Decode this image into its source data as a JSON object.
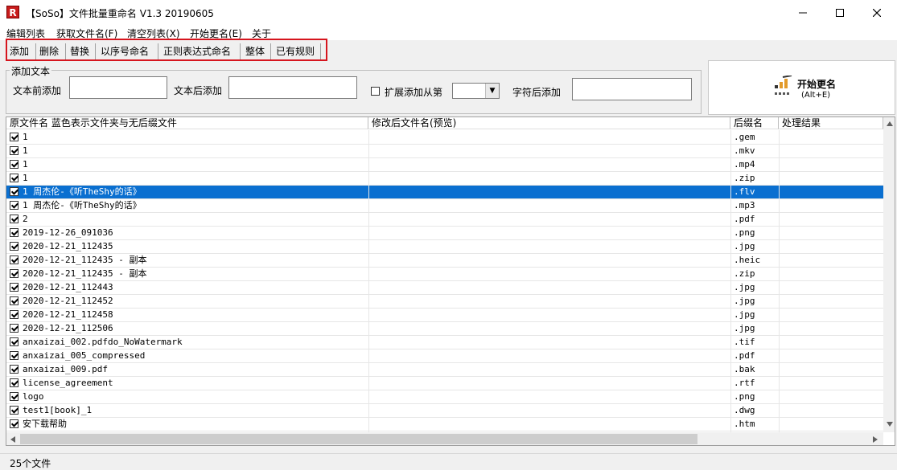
{
  "window": {
    "title": "【SoSo】文件批量重命名   V1.3 20190605",
    "icon_letter": "R"
  },
  "menu": [
    {
      "label": "编辑列表"
    },
    {
      "label": "获取文件名(F)"
    },
    {
      "label": "清空列表(X)"
    },
    {
      "label": "开始更名(E)"
    },
    {
      "label": "关于"
    }
  ],
  "tabs": [
    {
      "label": "添加"
    },
    {
      "label": "删除"
    },
    {
      "label": "替换"
    },
    {
      "label": "以序号命名"
    },
    {
      "label": "正则表达式命名"
    },
    {
      "label": "整体"
    },
    {
      "label": "已有规则"
    }
  ],
  "add_text": {
    "group_title": "添加文本",
    "before_label": "文本前添加",
    "after_label": "文本后添加",
    "extend_label": "扩展添加从第",
    "char_after_label": "字符后添加"
  },
  "start_button": {
    "label": "开始更名",
    "shortcut": "(Alt+E)"
  },
  "list": {
    "headers": {
      "name": "原文件名 蓝色表示文件夹与无后缀文件",
      "new_name": "修改后文件名(预览)",
      "ext": "后缀名",
      "result": "处理结果"
    },
    "rows": [
      {
        "name": "1",
        "ext": ".gem"
      },
      {
        "name": "1",
        "ext": ".mkv"
      },
      {
        "name": "1",
        "ext": ".mp4"
      },
      {
        "name": "1",
        "ext": ".zip"
      },
      {
        "name": "1 周杰伦-《听TheShy的话》",
        "ext": ".flv",
        "selected": true
      },
      {
        "name": "1 周杰伦-《听TheShy的话》",
        "ext": ".mp3"
      },
      {
        "name": "2",
        "ext": ".pdf"
      },
      {
        "name": "2019-12-26_091036",
        "ext": ".png"
      },
      {
        "name": "2020-12-21_112435",
        "ext": ".jpg"
      },
      {
        "name": "2020-12-21_112435 - 副本",
        "ext": ".heic"
      },
      {
        "name": "2020-12-21_112435 - 副本",
        "ext": ".zip"
      },
      {
        "name": "2020-12-21_112443",
        "ext": ".jpg"
      },
      {
        "name": "2020-12-21_112452",
        "ext": ".jpg"
      },
      {
        "name": "2020-12-21_112458",
        "ext": ".jpg"
      },
      {
        "name": "2020-12-21_112506",
        "ext": ".jpg"
      },
      {
        "name": "anxaizai_002.pdfdo_NoWatermark",
        "ext": ".tif"
      },
      {
        "name": "anxaizai_005_compressed",
        "ext": ".pdf"
      },
      {
        "name": "anxaizai_009.pdf",
        "ext": ".bak"
      },
      {
        "name": "license_agreement",
        "ext": ".rtf"
      },
      {
        "name": "logo",
        "ext": ".png"
      },
      {
        "name": "test1[book]_1",
        "ext": ".dwg"
      },
      {
        "name": "安下载帮助",
        "ext": ".htm"
      }
    ]
  },
  "status": {
    "text": "25个文件"
  },
  "colors": {
    "selection": "#0a6fd0",
    "highlight_box": "#d6151e"
  }
}
